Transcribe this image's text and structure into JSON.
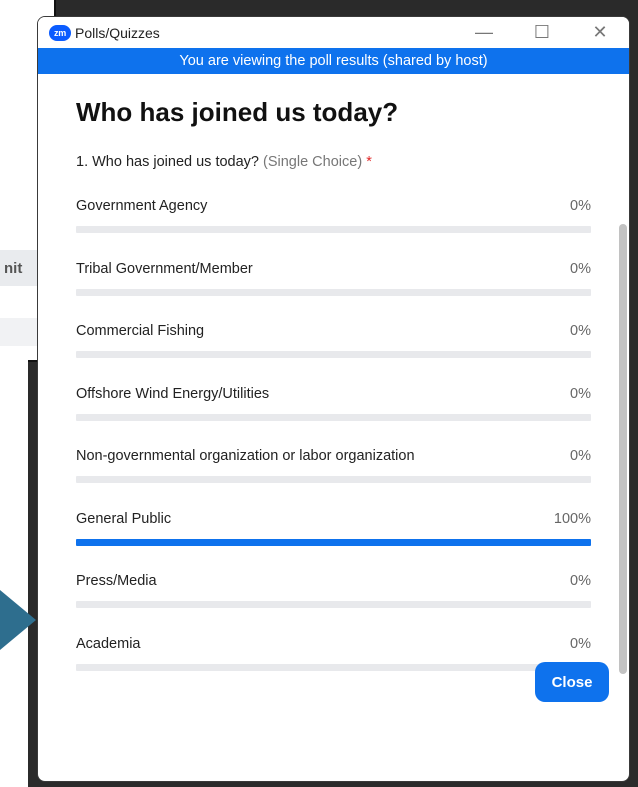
{
  "background": {
    "partial_text": "nit"
  },
  "window": {
    "app_logo": "zm",
    "title": "Polls/Quizzes",
    "controls": {
      "minimize": "—",
      "maximize": "☐",
      "close": "✕"
    }
  },
  "banner": {
    "text": "You are viewing the poll results (shared by host)"
  },
  "poll": {
    "title": "Who has joined us today?",
    "question": {
      "text": "1. Who has joined us today?",
      "type": "(Single Choice)",
      "required_mark": "*"
    },
    "options": [
      {
        "label": "Government Agency",
        "percent_text": "0%",
        "percent": 0
      },
      {
        "label": "Tribal Government/Member",
        "percent_text": "0%",
        "percent": 0
      },
      {
        "label": "Commercial Fishing",
        "percent_text": "0%",
        "percent": 0
      },
      {
        "label": "Offshore Wind Energy/Utilities",
        "percent_text": "0%",
        "percent": 0
      },
      {
        "label": "Non-governmental organization or labor organization",
        "percent_text": "0%",
        "percent": 0
      },
      {
        "label": "General Public",
        "percent_text": "100%",
        "percent": 100
      },
      {
        "label": "Press/Media",
        "percent_text": "0%",
        "percent": 0
      },
      {
        "label": "Academia",
        "percent_text": "0%",
        "percent": 0
      }
    ]
  },
  "footer": {
    "close_label": "Close"
  },
  "colors": {
    "accent": "#0e72ed",
    "bar_track": "#e8e9ec",
    "required": "#e02828"
  }
}
